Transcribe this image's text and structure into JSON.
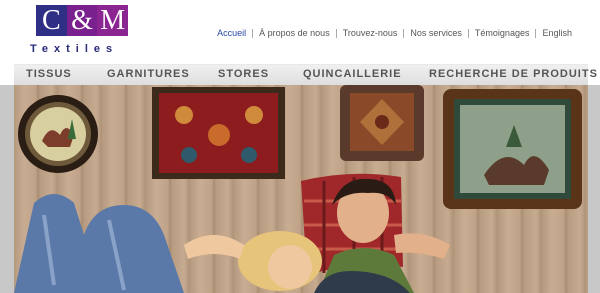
{
  "brand": {
    "logo_letters": [
      "C",
      "&",
      "M"
    ],
    "subtitle": "Textiles",
    "colors": {
      "navy": "#2f2f86",
      "purple": "#8a2592"
    }
  },
  "top_nav": [
    {
      "label": "Accueil",
      "active": true
    },
    {
      "label": "À propos de nous",
      "active": false
    },
    {
      "label": "Trouvez-nous",
      "active": false
    },
    {
      "label": "Nos services",
      "active": false
    },
    {
      "label": "Témoignages",
      "active": false
    },
    {
      "label": "English",
      "active": false
    }
  ],
  "main_nav": [
    {
      "label": "TISSUS"
    },
    {
      "label": "GARNITURES"
    },
    {
      "label": "STORES"
    },
    {
      "label": "QUINCAILLERIE"
    },
    {
      "label": "RECHERCHE DE PRODUITS"
    }
  ],
  "hero": {
    "image": "photo-of-couple-lying-on-pillows-below-framed-tapestries",
    "wall_color": "#bfa287"
  }
}
